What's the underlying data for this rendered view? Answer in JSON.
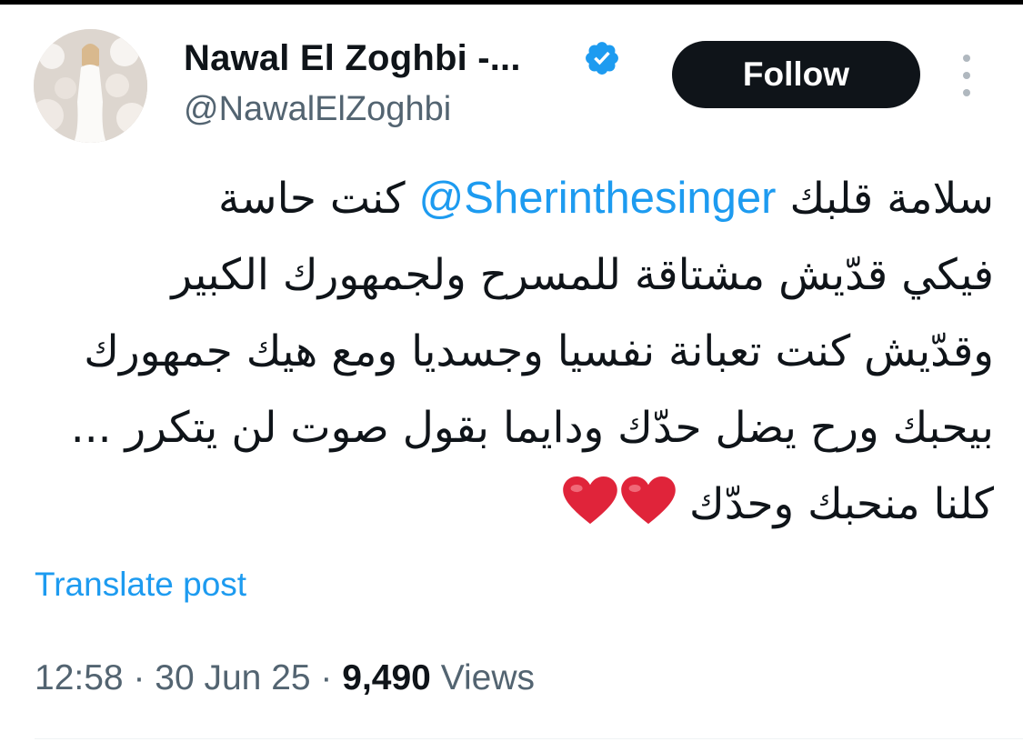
{
  "author": {
    "display_name": "Nawal El Zoghbi -...",
    "handle": "@NawalElZoghbi",
    "verified_icon": "verified-badge-icon"
  },
  "actions": {
    "follow_label": "Follow",
    "more_icon": "more-options-icon"
  },
  "tweet": {
    "line1_before": "سلامة قلبك ",
    "mention": "@Sherinthesinger",
    "line1_after": " كنت حاسة",
    "line2": "فيكي قدّيش مشتاقة للمسرح ولجمهورك الكبير",
    "line3": "وقدّيش كنت تعبانة نفسيا وجسديا ومع هيك جمهورك",
    "line4": "بيحبك ورح يضل حدّك ودايما بقول صوت لن يتكرر ...",
    "line5": "كلنا منحبك وحدّك",
    "emoji": "❤️❤️"
  },
  "translate_label": "Translate post",
  "meta": {
    "time": "12:58",
    "separator": " · ",
    "date": "30 Jun 25",
    "views_count": "9,490",
    "views_label": " Views"
  },
  "colors": {
    "accent": "#1d9bf0",
    "text": "#0f1419",
    "secondary": "#536471",
    "heart": "#e0243a"
  }
}
